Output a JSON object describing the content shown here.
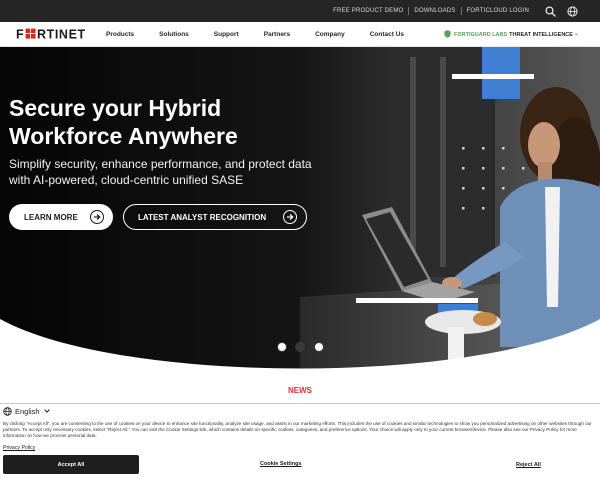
{
  "topbar": {
    "links": [
      "FREE PRODUCT DEMO",
      "DOWNLOADS",
      "FORTICLOUD LOGIN"
    ],
    "icons": [
      "search-icon",
      "globe-icon"
    ]
  },
  "nav": {
    "logo_text": "F#RTINET",
    "links": [
      "Products",
      "Solutions",
      "Support",
      "Partners",
      "Company",
      "Contact Us"
    ],
    "fortiguard": {
      "icon": "shield-icon",
      "part1": "FORTIGUARD LABS",
      "part2": "THREAT INTELLIGENCE",
      "arrow": "»"
    }
  },
  "hero": {
    "title_line1": "Secure your Hybrid",
    "title_line2": "Workforce Anywhere",
    "subtitle_line1": "Simplify security, enhance performance, and protect data",
    "subtitle_line2": "with AI-powered, cloud-centric unified SASE",
    "btn_learn_more": "LEARN MORE",
    "btn_recognition": "LATEST ANALYST RECOGNITION",
    "carousel_total": 3,
    "carousel_active": 2
  },
  "news": {
    "label": "NEWS"
  },
  "cookie": {
    "language": "English",
    "text": "By clicking \"Accept All\", you are consenting to the use of cookies on your device to enhance site functionality, analyze site usage, and assist in our marketing efforts. This includes the use of cookies and similar technologies to show you personalized advertising on other websites through our partners. To accept only necessary cookies, select \"Reject All.\" You can visit the Cookie Settings link, which contains details on specific cookies, categories, and preference options. Your choice will apply only to your current browser/device. Please also see our Privacy Policy for more information on how we process personal data.",
    "privacy_link": "Privacy Policy",
    "accept": "Accept All",
    "settings": "Cookie Settings",
    "reject": "Reject All"
  },
  "colors": {
    "topbar": "#262626",
    "accent_red": "#da291c",
    "fortiguard_green": "#55a25b",
    "news_red": "#d93131",
    "hero_blue": "#3f7fd1"
  }
}
